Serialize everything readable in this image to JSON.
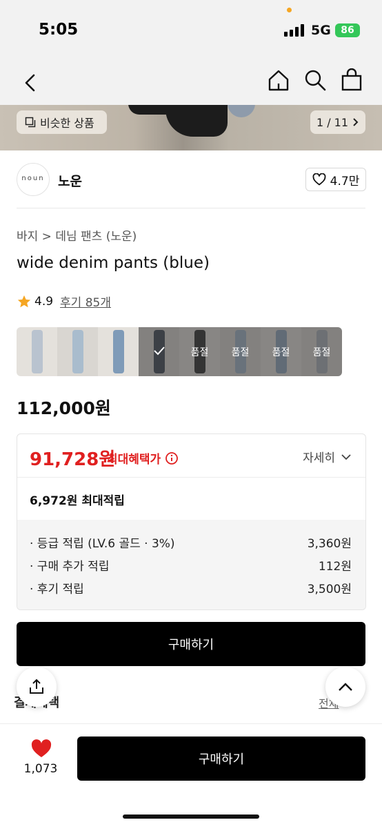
{
  "status": {
    "time": "5:05",
    "network": "5G",
    "battery": "86"
  },
  "hero": {
    "similar_label": "비슷한 상품",
    "counter": "1 / 11"
  },
  "brand": {
    "logo_text": "noun",
    "name": "노운",
    "likes": "4.7만"
  },
  "product": {
    "breadcrumb": "바지 > 데님 팬츠 (노운)",
    "title": "wide denim pants (blue)",
    "rating": "4.9",
    "reviews": "후기 85개",
    "price": "112,000원"
  },
  "swatches": [
    {
      "color": "#b9c3cf",
      "sold_out": false,
      "label": ""
    },
    {
      "color": "#a9bccd",
      "sold_out": false,
      "label": ""
    },
    {
      "color": "#7f9bb8",
      "sold_out": false,
      "label": ""
    },
    {
      "color": "#3c4552",
      "sold_out": false,
      "label": "",
      "selected": true
    },
    {
      "color": "#2a2a2a",
      "sold_out": true,
      "label": "품절"
    },
    {
      "color": "#9fb3c7",
      "sold_out": true,
      "label": "품절"
    },
    {
      "color": "#8ea4bd",
      "sold_out": true,
      "label": "품절"
    },
    {
      "color": "#a8b0b8",
      "sold_out": true,
      "label": "품절"
    }
  ],
  "benefit": {
    "max_price": "91,728원",
    "max_label": "최대혜택가",
    "detail_label": "자세히",
    "points_summary": "6,972원 최대적립",
    "rows": [
      {
        "label": "· 등급 적립 (LV.6 골드 · 3%)",
        "value": "3,360원"
      },
      {
        "label": "· 구매 추가 적립",
        "value": "112원"
      },
      {
        "label": "· 후기 적립",
        "value": "3,500원"
      }
    ]
  },
  "buttons": {
    "buy_main": "구매하기",
    "buy_bottom": "구매하기"
  },
  "partial": {
    "left": "결제혜택",
    "right": "전체"
  },
  "bottom": {
    "heart_count": "1,073"
  },
  "colors": {
    "accent_red": "#e02020",
    "black": "#000000"
  }
}
